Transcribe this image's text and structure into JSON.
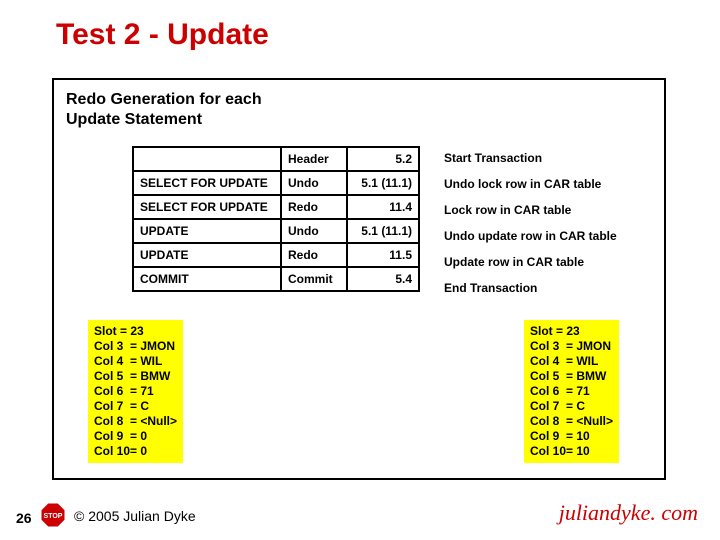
{
  "title": "Test 2 - Update",
  "subtitle": "Redo Generation for each\nUpdate Statement",
  "table": {
    "rows": [
      {
        "op": "",
        "type": "Header",
        "val": "5.2",
        "desc": "Start Transaction"
      },
      {
        "op": "SELECT FOR UPDATE",
        "type": "Undo",
        "val": "5.1 (11.1)",
        "desc": "Undo lock row in CAR table"
      },
      {
        "op": "SELECT FOR UPDATE",
        "type": "Redo",
        "val": "11.4",
        "desc": "Lock row in CAR table"
      },
      {
        "op": "UPDATE",
        "type": "Undo",
        "val": "5.1 (11.1)",
        "desc": "Undo update row in CAR table"
      },
      {
        "op": "UPDATE",
        "type": "Redo",
        "val": "11.5",
        "desc": "Update row in CAR table"
      },
      {
        "op": "COMMIT",
        "type": "Commit",
        "val": "5.4",
        "desc": "End Transaction"
      }
    ]
  },
  "boxLeft": "Slot = 23\nCol 3  = JMON\nCol 4  = WIL\nCol 5  = BMW\nCol 6  = 71\nCol 7  = C\nCol 8  = <Null>\nCol 9  = 0\nCol 10= 0",
  "boxRight": "Slot = 23\nCol 3  = JMON\nCol 4  = WIL\nCol 5  = BMW\nCol 6  = 71\nCol 7  = C\nCol 8  = <Null>\nCol 9  = 10\nCol 10= 10",
  "footer": {
    "page": "26",
    "stop": "STOP",
    "copyright": "© 2005 Julian Dyke",
    "brand": "juliandyke. com"
  }
}
